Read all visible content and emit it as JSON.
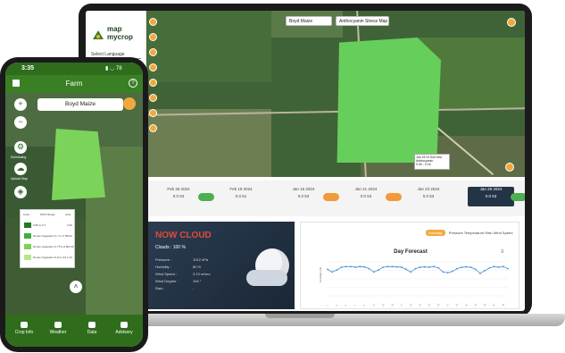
{
  "laptop": {
    "logo": {
      "line1": "map",
      "line2": "mycrop"
    },
    "language_select": "Select Language",
    "map": {
      "farm_select": "Boyd Maize",
      "layer_select": "Anthocyanin Stress Map",
      "infobox": [
        "Jan 15 Hi Soil ndvi",
        "Anthocyanin",
        "0.00 - 0.15"
      ]
    },
    "dates": [
      {
        "label": "Feb 26 2024",
        "value": "0.0 53",
        "status": "green"
      },
      {
        "label": "Feb 19 2024",
        "value": "0.0 51",
        "status": ""
      },
      {
        "label": "Jan 15 2024",
        "value": "0.0 53",
        "status": "orange"
      },
      {
        "label": "Jan 21 2024",
        "value": "0.0 53",
        "status": "orange"
      },
      {
        "label": "Jan 23 2024",
        "value": "0.0 53",
        "status": ""
      },
      {
        "label": "Jan 29 2024",
        "value": "0.0 53",
        "status": "green",
        "selected": true
      }
    ],
    "weather": {
      "title": "NOW CLOUD",
      "clouds": "Clouds : 100 %",
      "rows": [
        {
          "label": "Pressure :",
          "value": "1012 hPa"
        },
        {
          "label": "Humidity :",
          "value": "80 %"
        },
        {
          "label": "Wind Speed :",
          "value": "3.13 m/sec"
        },
        {
          "label": "Wind Degree :",
          "value": "154 °"
        },
        {
          "label": "Rain :",
          "value": "-"
        }
      ]
    },
    "forecast": {
      "tabs": [
        "Humidity",
        "Pressure",
        "Temperature",
        "Rain",
        "Wind Speed"
      ],
      "title": "Day Forecast",
      "menu": "≡"
    }
  },
  "phone": {
    "time": "3:35",
    "battery": "78",
    "title": "Farm",
    "farm_select": "Boyd Maize",
    "side_labels": [
      "Scheduling",
      "Upload Map"
    ],
    "legend": {
      "header": [
        "Color",
        "NDVI Range",
        "Area"
      ],
      "rows": [
        {
          "label": "0.80 to 0.7",
          "area": "2.69",
          "color": "#1f7a1f"
        },
        {
          "label": "Dense Vegetation 0.7 to 0.75",
          "area": "3.52",
          "color": "#3fae3a"
        },
        {
          "label": "Dense Vegetation 0.75 to 0.8",
          "area": "21.00",
          "color": "#7bd35a"
        },
        {
          "label": "Dense Vegetation 0.8 to 0.9",
          "area": "1.23",
          "color": "#b8e68a"
        }
      ]
    },
    "nav": [
      "Crop Info",
      "Weather",
      "Data",
      "Advisory"
    ]
  },
  "chart_data": {
    "type": "line",
    "title": "Day Forecast",
    "xlabel": "",
    "ylabel": "Humidity (%)",
    "ylim": [
      0,
      100
    ],
    "x": [
      1,
      2,
      3,
      4,
      5,
      6,
      7,
      8,
      9,
      10,
      11,
      12,
      13,
      14,
      15,
      16,
      17,
      18,
      19,
      20,
      21,
      22,
      23,
      24,
      25,
      26,
      27,
      28,
      29,
      30,
      31,
      32,
      33,
      34,
      35,
      36,
      37,
      38,
      39,
      40
    ],
    "series": [
      {
        "name": "Humidity",
        "values": [
          78,
          70,
          76,
          84,
          86,
          86,
          84,
          86,
          85,
          80,
          70,
          76,
          84,
          86,
          86,
          85,
          84,
          78,
          70,
          80,
          84,
          85,
          84,
          86,
          82,
          70,
          68,
          72,
          80,
          84,
          85,
          84,
          78,
          66,
          74,
          82,
          86,
          84,
          86,
          80
        ]
      }
    ],
    "color": "#4a90d9",
    "grid": true
  }
}
